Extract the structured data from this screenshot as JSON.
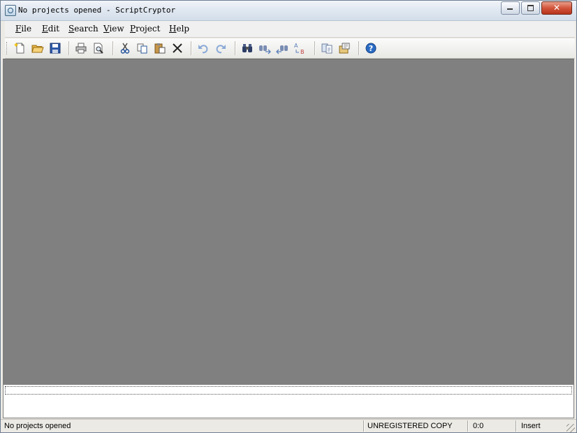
{
  "window": {
    "title": "No projects opened - ScriptCryptor"
  },
  "menu": [
    {
      "label": "File"
    },
    {
      "label": "Edit"
    },
    {
      "label": "Search"
    },
    {
      "label": "View"
    },
    {
      "label": "Project"
    },
    {
      "label": "Help"
    }
  ],
  "toolbar": {
    "icons": [
      "new-file-icon",
      "open-folder-icon",
      "save-icon",
      "print-icon",
      "print-preview-icon",
      "cut-icon",
      "copy-icon",
      "paste-icon",
      "delete-icon",
      "undo-icon",
      "redo-icon",
      "find-icon",
      "find-next-icon",
      "find-previous-icon",
      "replace-icon",
      "compile-icon",
      "project-settings-icon",
      "help-icon"
    ]
  },
  "statusbar": {
    "message": "No projects opened",
    "registration": "UNREGISTERED COPY",
    "position": "0:0",
    "mode": "Insert"
  },
  "colors": {
    "workspace": "#808080",
    "accent": "#1f5fae",
    "close_button": "#c9462c"
  }
}
